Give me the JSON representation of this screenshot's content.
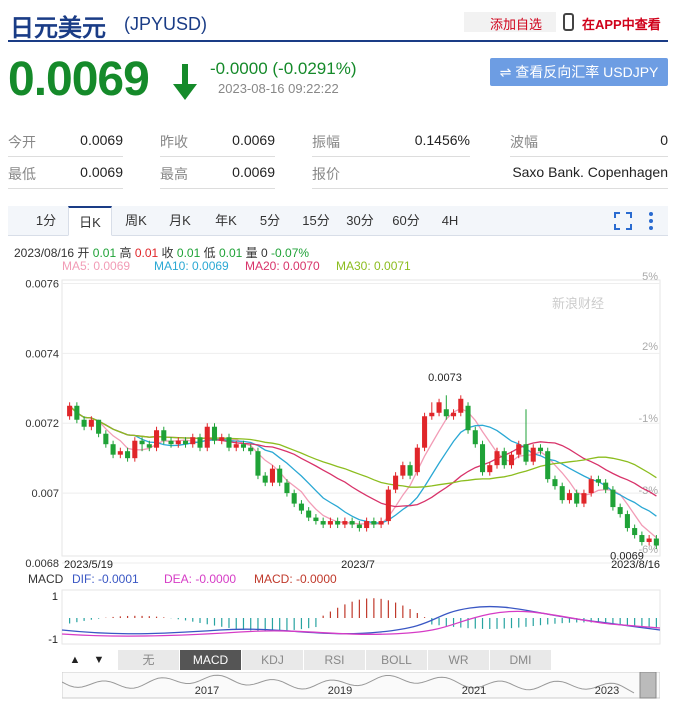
{
  "header": {
    "title": "日元美元",
    "symbol": "(JPYUSD)",
    "add_fav": "添加自选",
    "app_view": "在APP中查看"
  },
  "quote": {
    "price": "0.0069",
    "change": "-0.0000 (-0.0291%)",
    "time": "2023-08-16 09:22:22",
    "reverse_button": "查看反向汇率 USDJPY"
  },
  "stats": {
    "row1": [
      {
        "label": "今开",
        "value": "0.0069"
      },
      {
        "label": "昨收",
        "value": "0.0069"
      },
      {
        "label": "振幅",
        "value": "0.1456%"
      },
      {
        "label": "波幅",
        "value": "0"
      }
    ],
    "row2": [
      {
        "label": "最低",
        "value": "0.0069"
      },
      {
        "label": "最高",
        "value": "0.0069"
      },
      {
        "label": "报价",
        "value": "Saxo Bank. Copenhagen"
      }
    ]
  },
  "tabs": [
    "1分",
    "日K",
    "周K",
    "月K",
    "年K",
    "5分",
    "15分",
    "30分",
    "60分",
    "4H"
  ],
  "active_tab": "日K",
  "info_line": {
    "date": "2023/08/16",
    "open_l": "开",
    "open": "0.01",
    "high_l": "高",
    "high": "0.01",
    "close_l": "收",
    "close": "0.01",
    "low_l": "低",
    "low": "0.01",
    "vol_l": "量",
    "vol": "0",
    "pct": "-0.07%"
  },
  "ma_legend": [
    {
      "label": "MA5: 0.0069",
      "color": "#f29cb6"
    },
    {
      "label": "MA10: 0.0069",
      "color": "#2aa8d4"
    },
    {
      "label": "MA20: 0.0070",
      "color": "#d8336a"
    },
    {
      "label": "MA30: 0.0071",
      "color": "#8cbd1f"
    }
  ],
  "watermark": "新浪财经",
  "colors": {
    "up": "#e0262a",
    "down": "#1fa237",
    "accent": "#1a3c86"
  },
  "chart_data": {
    "type": "candlestick",
    "y_ticks_left": [
      "0.0076",
      "0.0074",
      "0.0072",
      "0.007",
      "0.0068"
    ],
    "y_ticks_right": [
      "5%",
      "2%",
      "-1%",
      "-3%",
      "-6%"
    ],
    "ylim": [
      0.00682,
      0.00761
    ],
    "x_labels": [
      "2023/5/19",
      "2023/7",
      "2023/8/16"
    ],
    "annotations": [
      {
        "text": "0.0073",
        "value": 0.00731
      },
      {
        "text": "0.0069",
        "value": 0.00685
      }
    ],
    "candles": [
      [
        0.00722,
        0.00725,
        0.00726,
        0.00721
      ],
      [
        0.00725,
        0.00721,
        0.00726,
        0.0072
      ],
      [
        0.00721,
        0.00719,
        0.00722,
        0.00718
      ],
      [
        0.00719,
        0.00721,
        0.00722,
        0.00718
      ],
      [
        0.00721,
        0.00717,
        0.00721,
        0.00716
      ],
      [
        0.00717,
        0.00714,
        0.00718,
        0.00713
      ],
      [
        0.00714,
        0.00711,
        0.00715,
        0.0071
      ],
      [
        0.00711,
        0.00712,
        0.00713,
        0.0071
      ],
      [
        0.00712,
        0.0071,
        0.00713,
        0.00709
      ],
      [
        0.0071,
        0.00715,
        0.00716,
        0.00709
      ],
      [
        0.00715,
        0.00714,
        0.00716,
        0.00712
      ],
      [
        0.00714,
        0.00713,
        0.00715,
        0.00712
      ],
      [
        0.00713,
        0.00718,
        0.00719,
        0.00712
      ],
      [
        0.00718,
        0.00715,
        0.00719,
        0.00714
      ],
      [
        0.00715,
        0.00714,
        0.00716,
        0.00713
      ],
      [
        0.00714,
        0.00715,
        0.00716,
        0.00713
      ],
      [
        0.00715,
        0.00714,
        0.00716,
        0.00713
      ],
      [
        0.00714,
        0.00716,
        0.00717,
        0.00713
      ],
      [
        0.00716,
        0.00713,
        0.00717,
        0.00712
      ],
      [
        0.00713,
        0.00719,
        0.0072,
        0.00712
      ],
      [
        0.00719,
        0.00715,
        0.0072,
        0.00714
      ],
      [
        0.00715,
        0.00716,
        0.00717,
        0.00714
      ],
      [
        0.00716,
        0.00713,
        0.00717,
        0.00712
      ],
      [
        0.00713,
        0.00714,
        0.00715,
        0.00712
      ],
      [
        0.00714,
        0.00713,
        0.00715,
        0.00712
      ],
      [
        0.00713,
        0.00712,
        0.00714,
        0.00711
      ],
      [
        0.00712,
        0.00705,
        0.00713,
        0.00704
      ],
      [
        0.00705,
        0.00703,
        0.00706,
        0.00702
      ],
      [
        0.00703,
        0.00707,
        0.00708,
        0.00702
      ],
      [
        0.00707,
        0.00703,
        0.00708,
        0.00702
      ],
      [
        0.00703,
        0.007,
        0.00704,
        0.00699
      ],
      [
        0.007,
        0.00697,
        0.00701,
        0.00696
      ],
      [
        0.00697,
        0.00695,
        0.00698,
        0.00694
      ],
      [
        0.00695,
        0.00693,
        0.00696,
        0.00692
      ],
      [
        0.00693,
        0.00692,
        0.00694,
        0.00691
      ],
      [
        0.00692,
        0.00691,
        0.00693,
        0.0069
      ],
      [
        0.00691,
        0.00692,
        0.00693,
        0.0069
      ],
      [
        0.00692,
        0.00691,
        0.00693,
        0.0069
      ],
      [
        0.00691,
        0.00692,
        0.00693,
        0.0069
      ],
      [
        0.00692,
        0.00691,
        0.00693,
        0.0069
      ],
      [
        0.00691,
        0.0069,
        0.00692,
        0.00689
      ],
      [
        0.0069,
        0.00692,
        0.00693,
        0.00689
      ],
      [
        0.00692,
        0.00691,
        0.00693,
        0.0069
      ],
      [
        0.00691,
        0.00692,
        0.00693,
        0.0069
      ],
      [
        0.00692,
        0.00701,
        0.00702,
        0.00691
      ],
      [
        0.00701,
        0.00705,
        0.00706,
        0.007
      ],
      [
        0.00705,
        0.00708,
        0.00709,
        0.00704
      ],
      [
        0.00708,
        0.00705,
        0.00709,
        0.00704
      ],
      [
        0.00706,
        0.00713,
        0.00714,
        0.00705
      ],
      [
        0.00713,
        0.00722,
        0.00723,
        0.00712
      ],
      [
        0.00722,
        0.00723,
        0.00726,
        0.00721
      ],
      [
        0.00723,
        0.00726,
        0.00727,
        0.00722
      ],
      [
        0.00724,
        0.00722,
        0.00728,
        0.00721
      ],
      [
        0.00722,
        0.00723,
        0.00724,
        0.00721
      ],
      [
        0.00723,
        0.00727,
        0.00728,
        0.00722
      ],
      [
        0.00725,
        0.00718,
        0.00726,
        0.00717
      ],
      [
        0.00718,
        0.00714,
        0.00719,
        0.00713
      ],
      [
        0.00714,
        0.00706,
        0.00715,
        0.00705
      ],
      [
        0.00706,
        0.00708,
        0.00709,
        0.00705
      ],
      [
        0.00708,
        0.00712,
        0.00713,
        0.00707
      ],
      [
        0.00712,
        0.00708,
        0.00713,
        0.00707
      ],
      [
        0.00708,
        0.00711,
        0.00712,
        0.00707
      ],
      [
        0.00711,
        0.00714,
        0.00715,
        0.0071
      ],
      [
        0.00714,
        0.00709,
        0.00724,
        0.00708
      ],
      [
        0.00709,
        0.00713,
        0.00714,
        0.00708
      ],
      [
        0.00713,
        0.00712,
        0.00714,
        0.00711
      ],
      [
        0.00712,
        0.00704,
        0.00713,
        0.00703
      ],
      [
        0.00704,
        0.00702,
        0.00705,
        0.00701
      ],
      [
        0.00702,
        0.00698,
        0.00703,
        0.00697
      ],
      [
        0.00698,
        0.007,
        0.00701,
        0.00697
      ],
      [
        0.007,
        0.00697,
        0.00701,
        0.00696
      ],
      [
        0.00697,
        0.007,
        0.00701,
        0.00696
      ],
      [
        0.007,
        0.00704,
        0.00705,
        0.00699
      ],
      [
        0.00704,
        0.00703,
        0.00705,
        0.00702
      ],
      [
        0.00703,
        0.00701,
        0.00704,
        0.007
      ],
      [
        0.00701,
        0.00696,
        0.00702,
        0.00695
      ],
      [
        0.00696,
        0.00694,
        0.00697,
        0.00693
      ],
      [
        0.00694,
        0.0069,
        0.00695,
        0.00689
      ],
      [
        0.0069,
        0.00688,
        0.00691,
        0.00687
      ],
      [
        0.00688,
        0.00686,
        0.00689,
        0.00685
      ],
      [
        0.00686,
        0.00687,
        0.00688,
        0.00685
      ],
      [
        0.00687,
        0.00685,
        0.00688,
        0.00684
      ]
    ],
    "macd": {
      "label": "MACD",
      "dif": "DIF: -0.0001",
      "dea": "DEA: -0.0000",
      "macd": "MACD: -0.0000",
      "ticks": [
        "1",
        "-1"
      ]
    }
  },
  "indicator_tabs": [
    "无",
    "MACD",
    "KDJ",
    "RSI",
    "BOLL",
    "WR",
    "DMI"
  ],
  "active_indicator": "MACD",
  "timeline_years": [
    "2017",
    "2019",
    "2021",
    "2023"
  ]
}
